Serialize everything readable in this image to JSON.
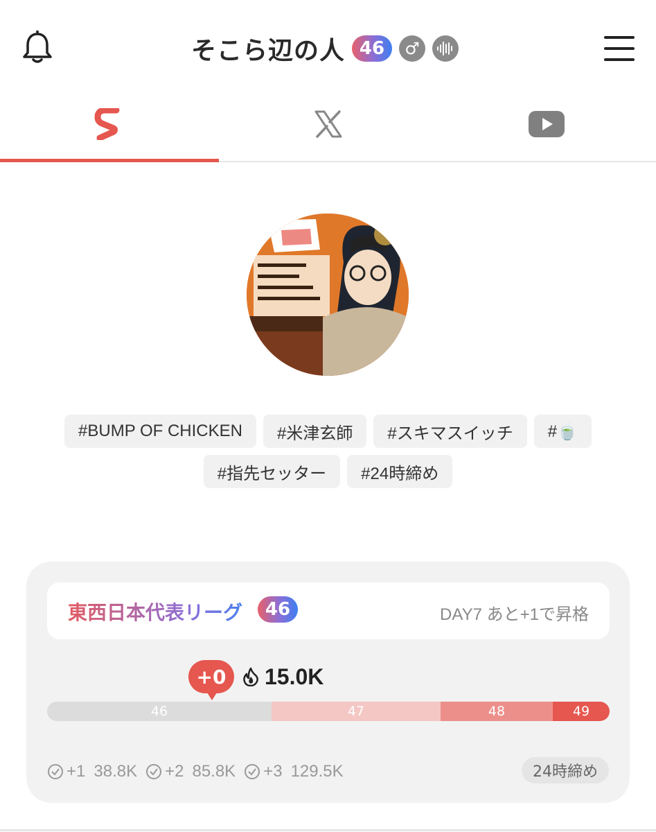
{
  "header": {
    "title": "そこら辺の人",
    "level": "46",
    "gender_symbol": "♂",
    "icons": [
      "bell-icon",
      "male-icon",
      "voice-waveform-icon",
      "hamburger-menu-icon"
    ]
  },
  "tabs": [
    {
      "name": "sokora-s-logo",
      "active": true
    },
    {
      "name": "x-logo",
      "active": false
    },
    {
      "name": "youtube-logo",
      "active": false
    }
  ],
  "colors": {
    "accent": "#e5574f",
    "gradient": [
      "#e8606a",
      "#8a6fd8",
      "#3d7ff0"
    ],
    "bar_segments": [
      "#dcdcdc",
      "#f4c7c5",
      "#ec8f8a",
      "#e5574f"
    ]
  },
  "tags": [
    "#BUMP OF CHICKEN",
    "#米津玄師",
    "#スキマスイッチ",
    "#🍵",
    "#指先セッター",
    "#24時締め"
  ],
  "league": {
    "name": "東西日本代表リーグ",
    "badge": "46",
    "status": "DAY7 あと+1で昇格",
    "delta": "+0",
    "score": "15.0K",
    "progress_segments": [
      {
        "label": "46"
      },
      {
        "label": "47"
      },
      {
        "label": "48"
      },
      {
        "label": "49"
      }
    ],
    "thresholds": [
      {
        "label": "+1",
        "value": "38.8K"
      },
      {
        "label": "+2",
        "value": "85.8K"
      },
      {
        "label": "+3",
        "value": "129.5K"
      }
    ],
    "deadline": "24時締め"
  }
}
